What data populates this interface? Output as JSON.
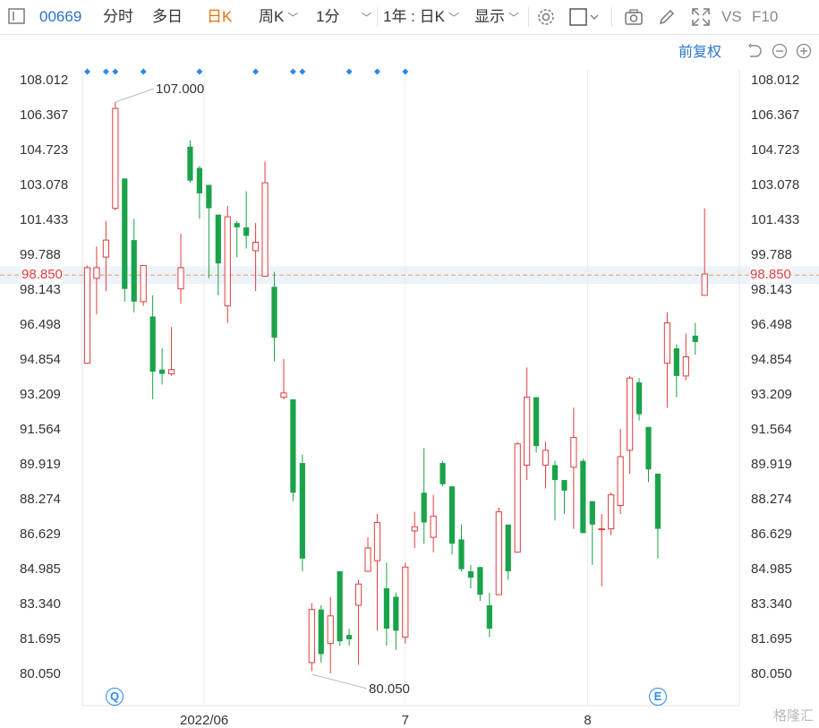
{
  "toolbar": {
    "code": "00669",
    "tab_fenshi": "分时",
    "tab_multiday": "多日",
    "tab_dayk": "日K",
    "weekk": "周K",
    "minute": "1分",
    "range": "1年 : 日K",
    "display": "显示",
    "vs": "VS",
    "f10": "F10"
  },
  "subbar": {
    "adjust": "前复权"
  },
  "colors": {
    "up": "#e03c3c",
    "down": "#1aa34a",
    "accent": "#2a73c9",
    "active_tab": "#e8710a",
    "price_line": "#e8a05a"
  },
  "event_markers": {
    "q": "Q",
    "e": "E"
  },
  "watermark": "格隆汇",
  "chart_data": {
    "type": "candlestick",
    "title": "",
    "ylim": [
      79.2,
      108.9
    ],
    "y_ticks": [
      "108.012",
      "106.367",
      "104.723",
      "103.078",
      "101.433",
      "99.788",
      "98.143",
      "96.498",
      "94.854",
      "93.209",
      "91.564",
      "89.919",
      "88.274",
      "86.629",
      "84.985",
      "83.340",
      "81.695",
      "80.050"
    ],
    "current_price": "98.850",
    "annotations": {
      "high": "107.000",
      "low": "80.050"
    },
    "x_labels": [
      {
        "label": "2022/06",
        "index": 12.5
      },
      {
        "label": "7",
        "index": 34
      },
      {
        "label": "8",
        "index": 53.5
      }
    ],
    "series": [
      {
        "o": 94.7,
        "h": 99.3,
        "l": 94.7,
        "c": 99.2
      },
      {
        "o": 98.7,
        "h": 100.2,
        "l": 97.0,
        "c": 99.2
      },
      {
        "o": 99.7,
        "h": 101.4,
        "l": 98.1,
        "c": 100.5
      },
      {
        "o": 102.0,
        "h": 107.0,
        "l": 101.9,
        "c": 106.7
      },
      {
        "o": 103.4,
        "h": 103.4,
        "l": 97.6,
        "c": 98.2
      },
      {
        "o": 100.5,
        "h": 101.5,
        "l": 97.1,
        "c": 97.6
      },
      {
        "o": 97.6,
        "h": 99.1,
        "l": 97.4,
        "c": 99.3
      },
      {
        "o": 96.9,
        "h": 97.9,
        "l": 93.0,
        "c": 94.3
      },
      {
        "o": 94.4,
        "h": 95.4,
        "l": 93.7,
        "c": 94.2
      },
      {
        "o": 94.2,
        "h": 96.4,
        "l": 94.1,
        "c": 94.4
      },
      {
        "o": 98.2,
        "h": 100.8,
        "l": 97.5,
        "c": 99.2
      },
      {
        "o": 104.9,
        "h": 105.2,
        "l": 103.2,
        "c": 103.3
      },
      {
        "o": 103.9,
        "h": 104.0,
        "l": 101.5,
        "c": 102.7
      },
      {
        "o": 103.1,
        "h": 103.1,
        "l": 98.7,
        "c": 102.0
      },
      {
        "o": 101.7,
        "h": 101.7,
        "l": 97.9,
        "c": 99.4
      },
      {
        "o": 97.4,
        "h": 102.1,
        "l": 96.6,
        "c": 101.6
      },
      {
        "o": 101.3,
        "h": 101.4,
        "l": 99.7,
        "c": 101.1
      },
      {
        "o": 101.1,
        "h": 102.8,
        "l": 100.1,
        "c": 100.7
      },
      {
        "o": 100.0,
        "h": 101.3,
        "l": 98.1,
        "c": 100.4
      },
      {
        "o": 98.8,
        "h": 104.2,
        "l": 98.8,
        "c": 103.2
      },
      {
        "o": 98.3,
        "h": 99.0,
        "l": 94.8,
        "c": 95.9
      },
      {
        "o": 93.1,
        "h": 94.9,
        "l": 93.0,
        "c": 93.3
      },
      {
        "o": 93.0,
        "h": 93.0,
        "l": 88.2,
        "c": 88.6
      },
      {
        "o": 90.0,
        "h": 90.4,
        "l": 84.9,
        "c": 85.5
      },
      {
        "o": 80.6,
        "h": 83.4,
        "l": 80.2,
        "c": 83.1
      },
      {
        "o": 83.1,
        "h": 83.3,
        "l": 80.6,
        "c": 81.0
      },
      {
        "o": 81.5,
        "h": 83.7,
        "l": 80.1,
        "c": 82.8
      },
      {
        "o": 84.9,
        "h": 84.9,
        "l": 81.4,
        "c": 81.6
      },
      {
        "o": 81.9,
        "h": 82.2,
        "l": 81.4,
        "c": 81.7
      },
      {
        "o": 83.3,
        "h": 84.5,
        "l": 80.5,
        "c": 84.3
      },
      {
        "o": 84.9,
        "h": 86.5,
        "l": 84.9,
        "c": 86.0
      },
      {
        "o": 85.4,
        "h": 87.6,
        "l": 82.1,
        "c": 87.2
      },
      {
        "o": 84.1,
        "h": 85.3,
        "l": 81.4,
        "c": 82.2
      },
      {
        "o": 83.7,
        "h": 83.9,
        "l": 81.2,
        "c": 82.1
      },
      {
        "o": 81.8,
        "h": 85.3,
        "l": 81.5,
        "c": 85.1
      },
      {
        "o": 86.8,
        "h": 87.7,
        "l": 86.0,
        "c": 87.0
      },
      {
        "o": 88.6,
        "h": 90.7,
        "l": 86.2,
        "c": 87.2
      },
      {
        "o": 86.5,
        "h": 88.5,
        "l": 85.8,
        "c": 87.5
      },
      {
        "o": 90.0,
        "h": 90.1,
        "l": 88.9,
        "c": 89.0
      },
      {
        "o": 88.9,
        "h": 88.9,
        "l": 85.7,
        "c": 86.2
      },
      {
        "o": 86.4,
        "h": 87.1,
        "l": 84.9,
        "c": 85.0
      },
      {
        "o": 84.9,
        "h": 85.2,
        "l": 84.1,
        "c": 84.6
      },
      {
        "o": 85.1,
        "h": 85.1,
        "l": 83.5,
        "c": 83.8
      },
      {
        "o": 83.3,
        "h": 83.9,
        "l": 81.8,
        "c": 82.2
      },
      {
        "o": 83.8,
        "h": 87.9,
        "l": 83.8,
        "c": 87.7
      },
      {
        "o": 87.1,
        "h": 87.1,
        "l": 84.5,
        "c": 84.9
      },
      {
        "o": 85.8,
        "h": 91.0,
        "l": 85.8,
        "c": 90.9
      },
      {
        "o": 89.9,
        "h": 94.5,
        "l": 89.2,
        "c": 93.1
      },
      {
        "o": 93.1,
        "h": 93.1,
        "l": 90.5,
        "c": 90.8
      },
      {
        "o": 89.9,
        "h": 91.0,
        "l": 88.8,
        "c": 90.6
      },
      {
        "o": 89.9,
        "h": 90.1,
        "l": 87.3,
        "c": 89.2
      },
      {
        "o": 89.2,
        "h": 89.2,
        "l": 87.6,
        "c": 88.7
      },
      {
        "o": 89.8,
        "h": 92.6,
        "l": 86.9,
        "c": 91.2
      },
      {
        "o": 90.1,
        "h": 90.2,
        "l": 86.7,
        "c": 86.7
      },
      {
        "o": 88.2,
        "h": 88.2,
        "l": 85.2,
        "c": 87.1
      },
      {
        "o": 86.9,
        "h": 87.6,
        "l": 84.2,
        "c": 86.9
      },
      {
        "o": 86.9,
        "h": 88.6,
        "l": 86.6,
        "c": 88.5
      },
      {
        "o": 88.0,
        "h": 91.6,
        "l": 87.6,
        "c": 90.3
      },
      {
        "o": 90.6,
        "h": 94.1,
        "l": 89.5,
        "c": 94.0
      },
      {
        "o": 93.8,
        "h": 94.0,
        "l": 92.0,
        "c": 92.3
      },
      {
        "o": 91.7,
        "h": 91.7,
        "l": 89.1,
        "c": 89.7
      },
      {
        "o": 89.5,
        "h": 89.5,
        "l": 85.5,
        "c": 86.9
      },
      {
        "o": 94.7,
        "h": 97.1,
        "l": 92.6,
        "c": 96.6
      },
      {
        "o": 95.4,
        "h": 95.6,
        "l": 93.1,
        "c": 94.1
      },
      {
        "o": 94.1,
        "h": 96.1,
        "l": 93.9,
        "c": 95.0
      },
      {
        "o": 96.0,
        "h": 96.6,
        "l": 95.1,
        "c": 95.7
      },
      {
        "o": 97.9,
        "h": 102.0,
        "l": 97.9,
        "c": 98.9
      }
    ],
    "event_marker_indices": [
      0,
      2,
      3,
      6,
      12,
      18,
      22,
      23,
      28,
      31,
      34
    ]
  }
}
